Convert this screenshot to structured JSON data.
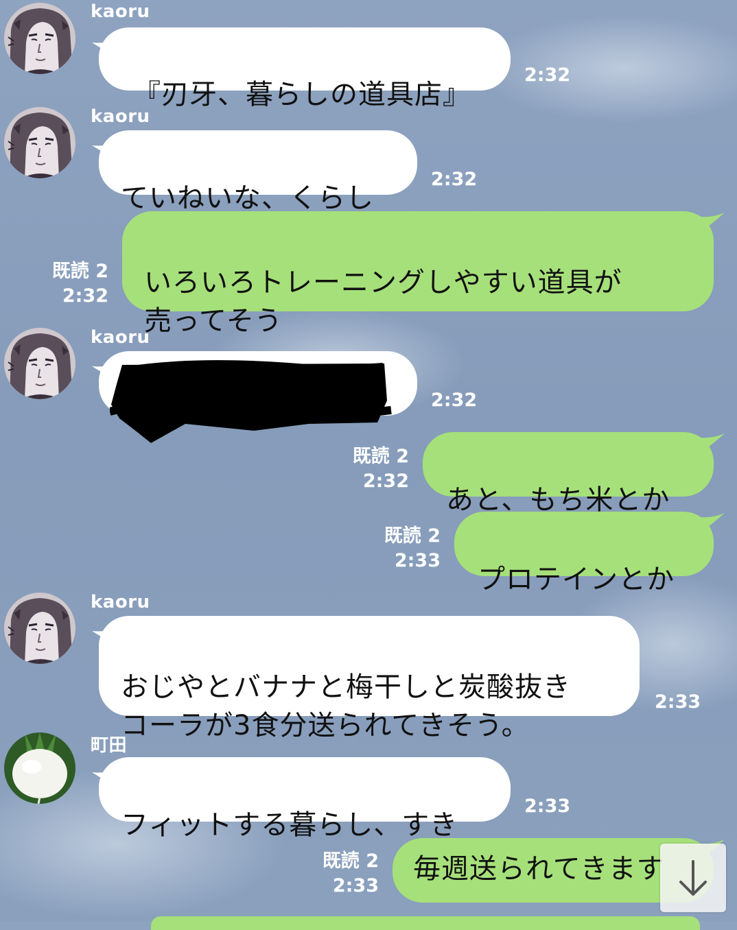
{
  "messages": [
    {
      "sender": "kaoru",
      "text": "『刃牙、暮らしの道具店』",
      "time": "2:32"
    },
    {
      "sender": "kaoru",
      "text": "ていねいな、くらし",
      "time": "2:32"
    },
    {
      "read": "既読 2",
      "text": "いろいろトレーニングしやすい道具が\n売ってそう",
      "time": "2:32"
    },
    {
      "sender": "kaoru",
      "text": "",
      "time": "2:32"
    },
    {
      "read": "既読 2",
      "text": "あと、もち米とか",
      "time": "2:32"
    },
    {
      "read": "既読 2",
      "text": "プロテインとか",
      "time": "2:33"
    },
    {
      "sender": "kaoru",
      "text": "おじやとバナナと梅干しと炭酸抜き\nコーラが3食分送られてきそう。",
      "time": "2:33"
    },
    {
      "sender": "町田",
      "text": "フィットする暮らし、すき",
      "time": "2:33"
    },
    {
      "read": "既読 2",
      "text": "毎週送られてきます",
      "time": "2:33"
    }
  ],
  "icons": {
    "kaoru_avatar": "anime-portrait-avatar",
    "machida_avatar": "turnip-avatar",
    "scroll_down": "arrow-down-icon"
  },
  "colors": {
    "incoming_bubble": "#ffffff",
    "outgoing_bubble": "#a6e07a",
    "background": "#8ea3c0",
    "meta_text": "#ffffff"
  }
}
